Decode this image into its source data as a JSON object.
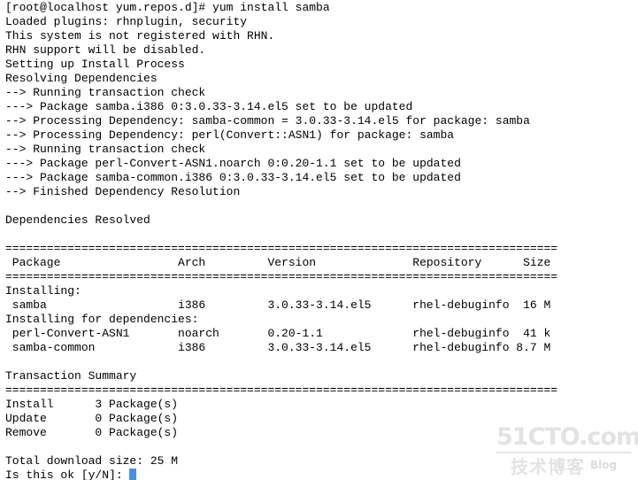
{
  "terminal": {
    "prompt": "[root@localhost yum.repos.d]# yum install samba",
    "lines": [
      "[root@localhost yum.repos.d]# yum install samba",
      "Loaded plugins: rhnplugin, security",
      "This system is not registered with RHN.",
      "RHN support will be disabled.",
      "Setting up Install Process",
      "Resolving Dependencies",
      "--> Running transaction check",
      "---> Package samba.i386 0:3.0.33-3.14.el5 set to be updated",
      "--> Processing Dependency: samba-common = 3.0.33-3.14.el5 for package: samba",
      "--> Processing Dependency: perl(Convert::ASN1) for package: samba",
      "--> Running transaction check",
      "---> Package perl-Convert-ASN1.noarch 0:0.20-1.1 set to be updated",
      "---> Package samba-common.i386 0:3.0.33-3.14.el5 set to be updated",
      "--> Finished Dependency Resolution",
      "",
      "Dependencies Resolved",
      "",
      "================================================================================",
      " Package                 Arch         Version              Repository      Size",
      "================================================================================",
      "Installing:",
      " samba                   i386         3.0.33-3.14.el5      rhel-debuginfo  16 M",
      "Installing for dependencies:",
      " perl-Convert-ASN1       noarch       0.20-1.1             rhel-debuginfo  41 k",
      " samba-common            i386         3.0.33-3.14.el5      rhel-debuginfo 8.7 M",
      "",
      "Transaction Summary",
      "================================================================================",
      "Install      3 Package(s)",
      "Update       0 Package(s)",
      "Remove       0 Package(s)",
      "",
      "Total download size: 25 M",
      "Is this ok [y/N]:"
    ],
    "final_prompt": "Is this ok [y/N]: ",
    "cursor_color": "#4a90e2",
    "background_color": "#ffffff",
    "text_color": "#000000"
  },
  "table": {
    "headers": [
      "Package",
      "Arch",
      "Version",
      "Repository",
      "Size"
    ],
    "section_installing": "Installing:",
    "section_dependencies": "Installing for dependencies:",
    "rows": [
      {
        "package": "samba",
        "arch": "i386",
        "version": "3.0.33-3.14.el5",
        "repository": "rhel-debuginfo",
        "size": "16 M"
      },
      {
        "package": "perl-Convert-ASN1",
        "arch": "noarch",
        "version": "0.20-1.1",
        "repository": "rhel-debuginfo",
        "size": "41 k"
      },
      {
        "package": "samba-common",
        "arch": "i386",
        "version": "3.0.33-3.14.el5",
        "repository": "rhel-debuginfo",
        "size": "8.7 M"
      }
    ]
  },
  "summary": {
    "title": "Transaction Summary",
    "install_label": "Install",
    "install_count": "3 Package(s)",
    "update_label": "Update",
    "update_count": "0 Package(s)",
    "remove_label": "Remove",
    "remove_count": "0 Package(s)",
    "total_download_size": "Total download size: 25 M"
  },
  "watermark": {
    "top": "51CTO.com",
    "bottom_cn": "技术博客",
    "bottom_en": "Blog"
  }
}
